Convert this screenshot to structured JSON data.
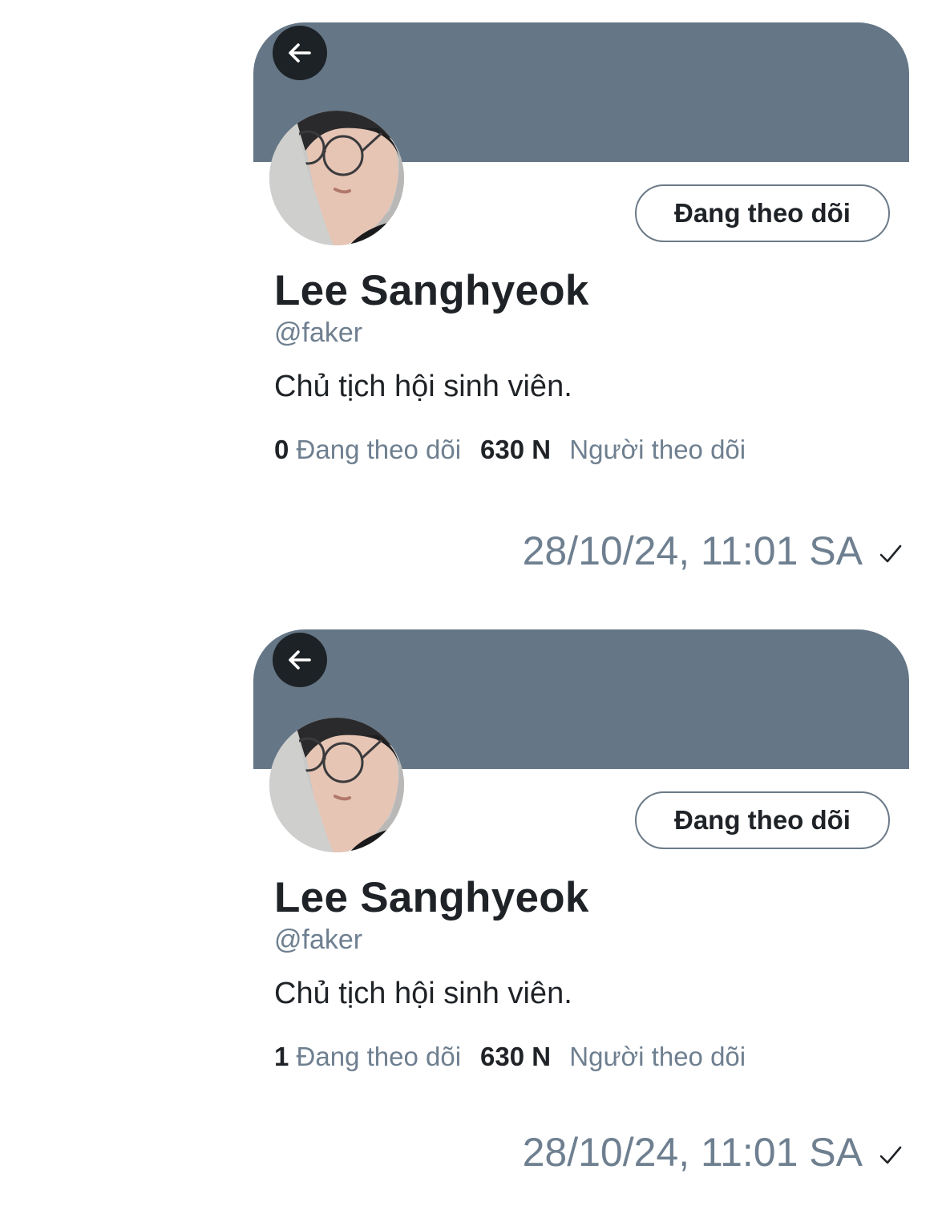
{
  "messages": [
    {
      "profile": {
        "back_icon": "arrow-left-icon",
        "follow_button": "Đang theo dõi",
        "name": "Lee Sanghyeok",
        "handle": "@faker",
        "bio": "Chủ tịch hội sinh viên.",
        "following_count": "0",
        "following_label": "Đang theo dõi",
        "followers_count": "630 N",
        "followers_label": "Người theo dõi"
      },
      "timestamp": "28/10/24, 11:01 SA",
      "status_icon": "checkmark-icon"
    },
    {
      "profile": {
        "back_icon": "arrow-left-icon",
        "follow_button": "Đang theo dõi",
        "name": "Lee Sanghyeok",
        "handle": "@faker",
        "bio": "Chủ tịch hội sinh viên.",
        "following_count": "1",
        "following_label": "Đang theo dõi",
        "followers_count": "630 N",
        "followers_label": "Người theo dõi"
      },
      "timestamp": "28/10/24, 11:01 SA",
      "status_icon": "checkmark-icon"
    }
  ],
  "colors": {
    "banner": "#657686",
    "back_button": "#1d2226",
    "muted_text": "#6e7f90",
    "primary_text": "#1f2327"
  }
}
